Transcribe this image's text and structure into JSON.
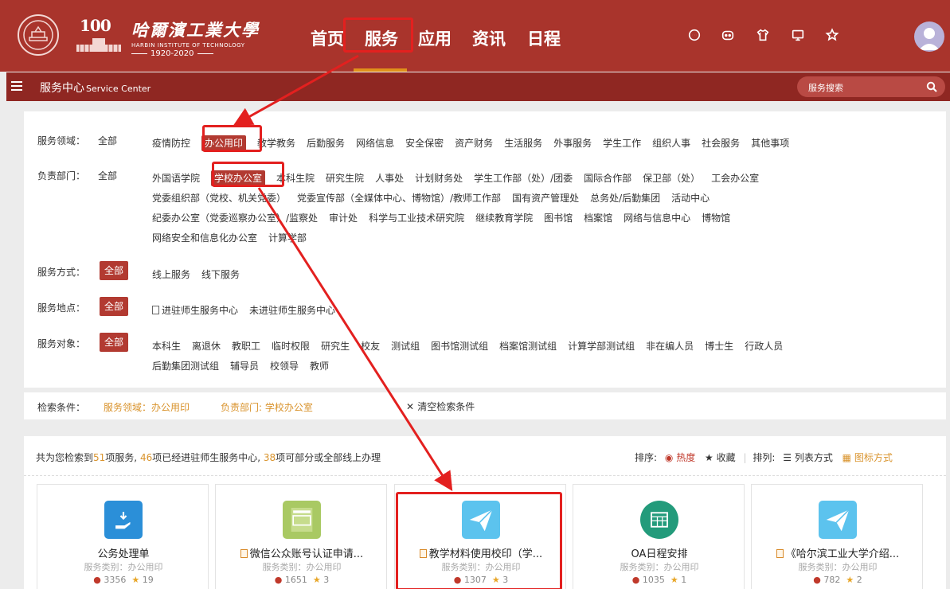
{
  "header": {
    "logo_number": "100",
    "school_name_cn": "哈爾濱工業大學",
    "school_name_en": "HARBIN INSTITUTE OF TECHNOLOGY",
    "years": "1920-2020",
    "nav": [
      "首页",
      "服务",
      "应用",
      "资讯",
      "日程"
    ],
    "active_nav": "服务"
  },
  "subheader": {
    "title": "服务中心",
    "title_en": "Service Center",
    "search_placeholder": "服务搜索"
  },
  "filters": {
    "all_label": "全部",
    "domain": {
      "label": "服务领域：",
      "options": [
        "疫情防控",
        "办公用印",
        "教学教务",
        "后勤服务",
        "网络信息",
        "安全保密",
        "资产财务",
        "生活服务",
        "外事服务",
        "学生工作",
        "组织人事",
        "社会服务",
        "其他事项"
      ],
      "selected": "办公用印"
    },
    "department": {
      "label": "负责部门：",
      "options": [
        "外国语学院",
        "学校办公室",
        "本科生院",
        "研究生院",
        "人事处",
        "计划财务处",
        "学生工作部（处）/团委",
        "国际合作部",
        "保卫部（处）",
        "工会办公室",
        "党委组织部（党校、机关党委）",
        "党委宣传部（全媒体中心、博物馆）/教师工作部",
        "国有资产管理处",
        "总务处/后勤集团",
        "活动中心",
        "纪委办公室（党委巡察办公室）/监察处",
        "审计处",
        "科学与工业技术研究院",
        "继续教育学院",
        "图书馆",
        "档案馆",
        "网络与信息中心",
        "博物馆",
        "网络安全和信息化办公室",
        "计算学部"
      ],
      "selected": "学校办公室"
    },
    "method": {
      "label": "服务方式：",
      "options": [
        "线上服务",
        "线下服务"
      ]
    },
    "location": {
      "label": "服务地点：",
      "options": [
        "进驻师生服务中心",
        "未进驻师生服务中心"
      ]
    },
    "audience": {
      "label": "服务对象：",
      "options": [
        "本科生",
        "离退休",
        "教职工",
        "临时权限",
        "研究生",
        "校友",
        "测试组",
        "图书馆测试组",
        "档案馆测试组",
        "计算学部测试组",
        "非在编人员",
        "博士生",
        "行政人员",
        "后勤集团测试组",
        "辅导员",
        "校领导",
        "教师"
      ]
    }
  },
  "criteria": {
    "label": "检索条件：",
    "domain": "服务领域：办公用印",
    "department": "负责部门: 学校办公室",
    "clear": "清空检索条件"
  },
  "results": {
    "prefix": "共为您检索到",
    "total": "51",
    "mid1": "项服务,",
    "in_center": "46",
    "mid2": "项已经进驻师生服务中心,",
    "online": "38",
    "suffix": "项可部分或全部线上办理",
    "sort_label": "排序:",
    "sort_hot": "热度",
    "sort_fav": "收藏",
    "view_label": "排列:",
    "view_list": "列表方式",
    "view_icon": "图标方式",
    "cards": [
      {
        "title": "公务处理单",
        "category": "服务类别：办公用印",
        "views": "3356",
        "stars": "19",
        "doc": false
      },
      {
        "title": "微信公众账号认证申请...",
        "category": "服务类别：办公用印",
        "views": "1651",
        "stars": "3",
        "doc": true
      },
      {
        "title": "教学材料使用校印（学...",
        "category": "服务类别：办公用印",
        "views": "1307",
        "stars": "3",
        "doc": true
      },
      {
        "title": "OA日程安排",
        "category": "服务类别：办公用印",
        "views": "1035",
        "stars": "1",
        "doc": false
      },
      {
        "title": "《哈尔滨工业大学介绍...",
        "category": "服务类别：办公用印",
        "views": "782",
        "stars": "2",
        "doc": true
      }
    ]
  },
  "colors": {
    "header": "#a9342c",
    "subheader": "#8f2722",
    "accent": "#b23a31",
    "highlight": "#e3201f",
    "orange": "#d9932c"
  }
}
